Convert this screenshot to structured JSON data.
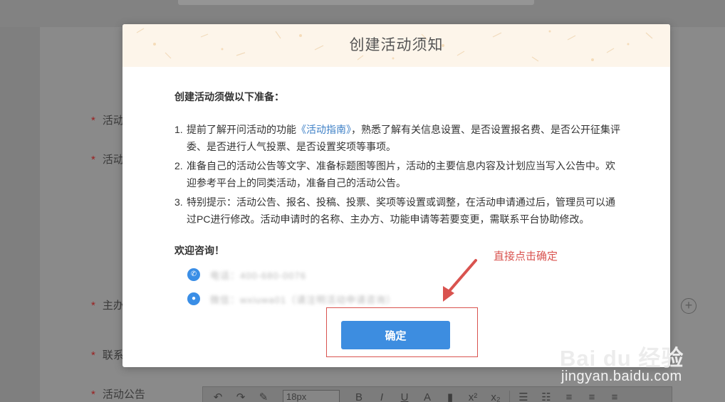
{
  "background": {
    "labels": {
      "row1": "活动",
      "row2": "活动",
      "row3": "主办",
      "row4": "联系",
      "row5": "活动公告"
    },
    "required_mark": "*",
    "plus_symbol": "+",
    "editor_toolbar": {
      "font_size": "18px",
      "bold": "B",
      "italic": "I",
      "underline": "U",
      "font_color": "A",
      "superscript": "x²",
      "subscript": "x₂"
    }
  },
  "modal": {
    "title": "创建活动须知",
    "intro": "创建活动须做以下准备：",
    "items": [
      {
        "num": "1.",
        "text_before": "提前了解开问活动的功能",
        "link": "《活动指南》",
        "text_after": "，熟悉了解有关信息设置、是否设置报名费、是否公开征集评委、是否进行人气投票、是否设置奖项等事项。"
      },
      {
        "num": "2.",
        "text": "准备自己的活动公告等文字、准备标题图等图片，活动的主要信息内容及计划应当写入公告中。欢迎参考平台上的同类活动，准备自己的活动公告。"
      },
      {
        "num": "3.",
        "text": "特别提示：活动公告、报名、投稿、投票、奖项等设置或调整，在活动申请通过后，管理员可以通过PC进行修改。活动申请时的名称、主办方、功能申请等若要变更，需联系平台协助修改。"
      }
    ],
    "welcome": "欢迎咨询！",
    "contacts": [
      {
        "icon": "phone-icon",
        "text": "电话：400-680-0076"
      },
      {
        "icon": "wechat-icon",
        "text": "微信：wxiuwa01（请注明活动申请咨询）"
      }
    ],
    "confirm_label": "确定"
  },
  "annotation": {
    "text": "直接点击确定",
    "color": "#d9534f"
  },
  "watermark": {
    "logo": "Bai du 经验",
    "url": "jingyan.baidu.com"
  },
  "colors": {
    "link": "#3c7fc6",
    "button": "#3d8de0",
    "annotation": "#d9534f"
  }
}
